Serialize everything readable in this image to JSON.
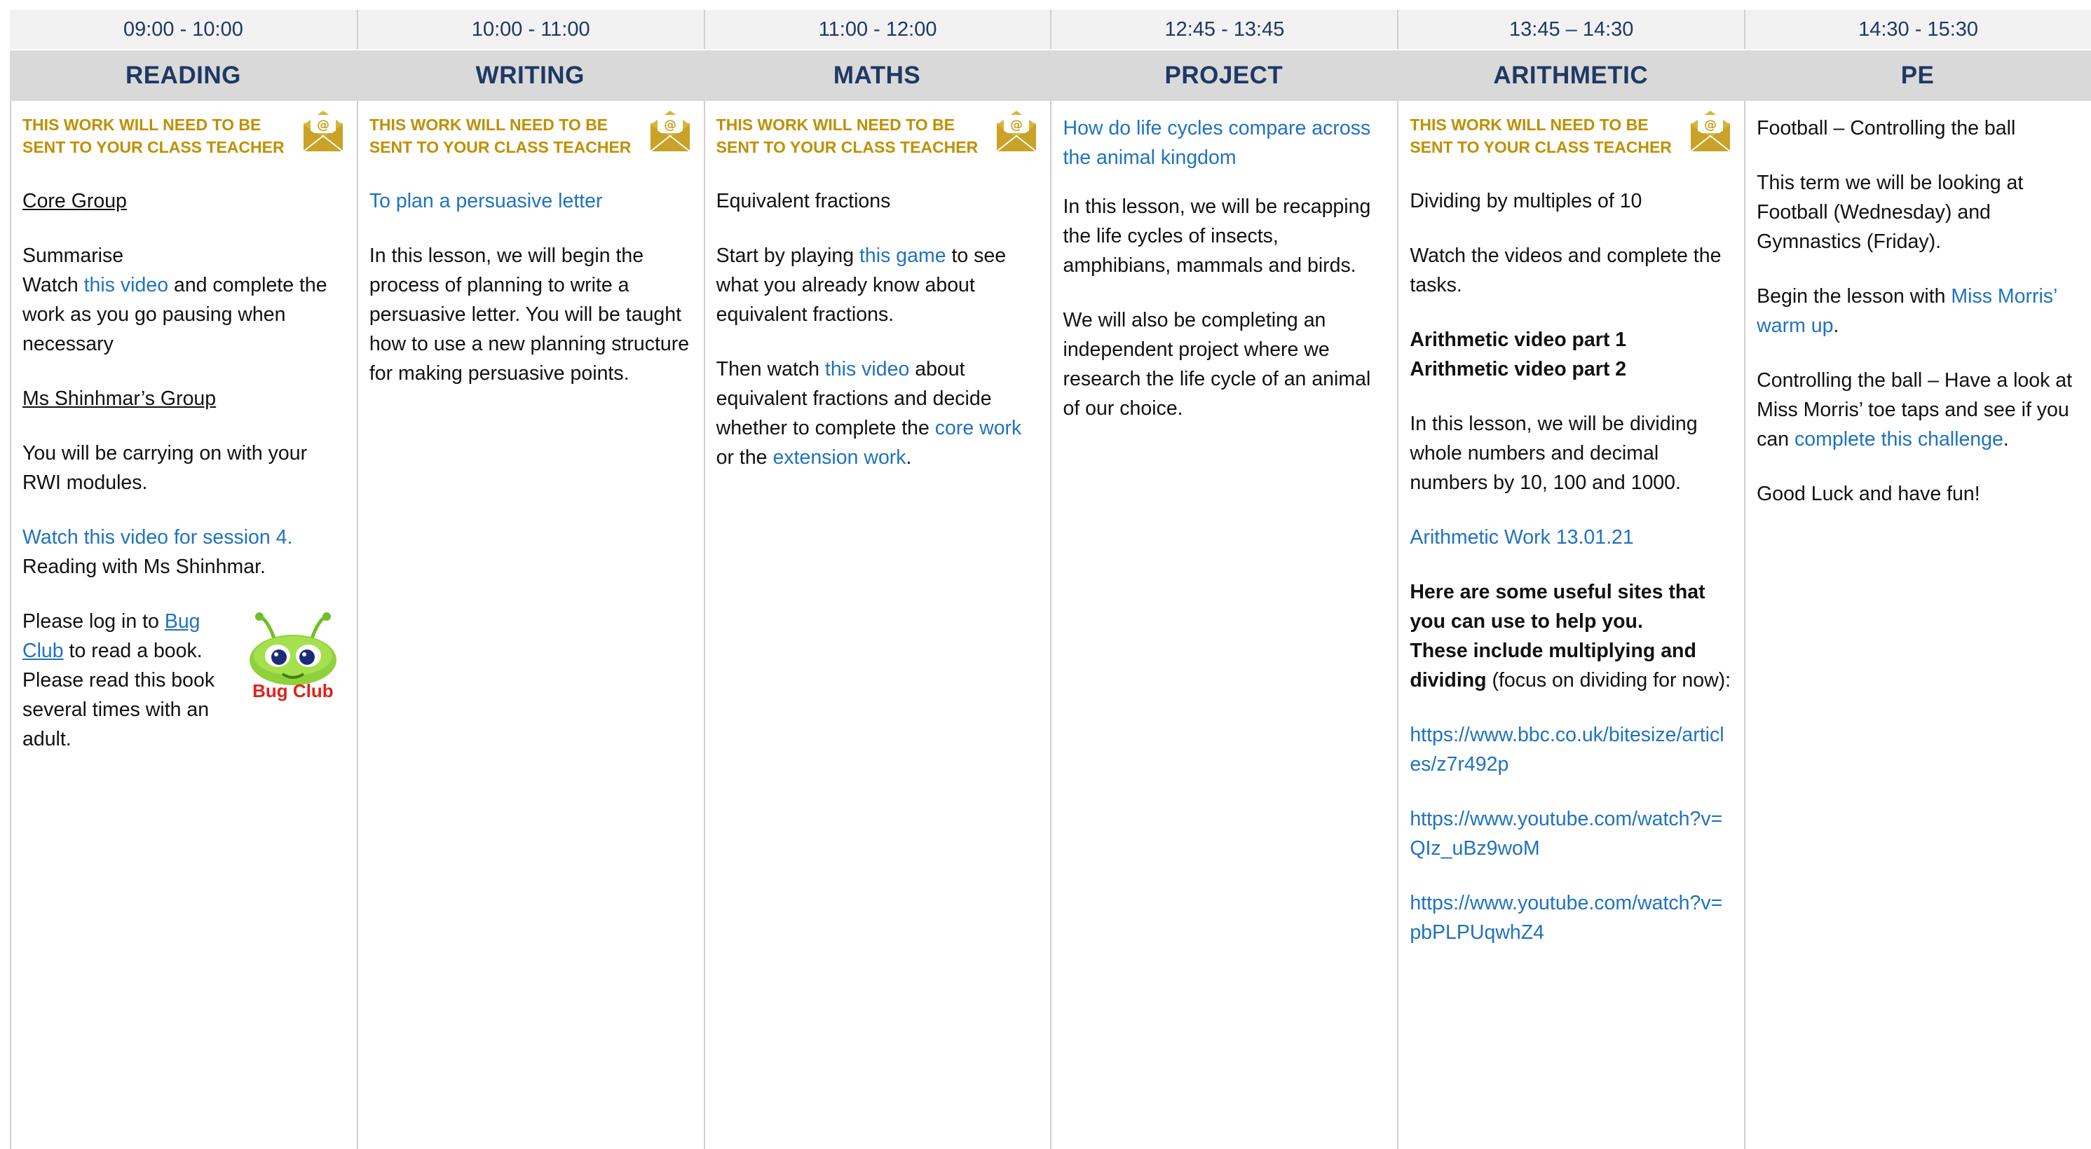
{
  "times": [
    "09:00 - 10:00",
    "10:00 - 11:00",
    "11:00 - 12:00",
    "12:45 - 13:45",
    "13:45 – 14:30",
    "14:30 - 15:30"
  ],
  "subjects": [
    "READING",
    "WRITING",
    "MATHS",
    "PROJECT",
    "ARITHMETIC",
    "PE"
  ],
  "notice": {
    "line1": "THIS WORK WILL NEED TO BE",
    "line2": "SENT TO YOUR CLASS TEACHER",
    "icon": "mail-icon",
    "color": "#bf9000"
  },
  "colors": {
    "heading": "#1f3864",
    "link": "#1f72c0",
    "time_bg": "#f2f2f2",
    "subject_bg": "#d9d9d9"
  },
  "reading": {
    "core_group": "Core Group",
    "summarise": "Summarise",
    "watch_prefix": "Watch ",
    "watch_link": "this video",
    "watch_suffix": " and complete the work as you go pausing when necessary",
    "group2": "Ms Shinhmar’s Group",
    "rwi": "You will be carrying on with your RWI modules.",
    "session_link": "Watch this video for session 4.",
    "session_text": "Reading with Ms Shinhmar.",
    "bug_prefix": "Please log in to ",
    "bug_link1": "Bug",
    "bug_link2": "Club",
    "bug_suffix": " to read a book. Please read this book several times with an adult.",
    "bug_logo": "Bug Club"
  },
  "writing": {
    "objective": "To plan a persuasive letter",
    "body": "In this lesson, we will begin the process of planning to write a persuasive letter. You will be taught how to use a new planning structure for making persuasive points."
  },
  "maths": {
    "topic": "Equivalent fractions",
    "start_prefix": "Start by playing ",
    "game_link": "this game",
    "start_suffix": " to see what you already know about equivalent fractions.",
    "then_prefix": "Then watch ",
    "video_link": "this video",
    "then_mid": " about equivalent fractions and decide whether to complete the ",
    "core_link": "core work",
    "or_text": " or the ",
    "extension_link": "extension work",
    "end": "."
  },
  "project": {
    "question": "How do life cycles compare across the animal kingdom",
    "para1": "In this lesson, we will be recapping the life cycles of insects, amphibians, mammals and birds.",
    "para2": "We will also be completing an independent project where we research the life cycle of an animal of our choice."
  },
  "arithmetic": {
    "topic": "Dividing by multiples of 10",
    "watch": "Watch the videos and complete the tasks.",
    "video1": "Arithmetic video part 1",
    "video2": "Arithmetic video part 2",
    "lesson": "In this lesson, we will be dividing whole numbers and decimal numbers by 10, 100 and 1000.",
    "work_link": "Arithmetic Work 13.01.21",
    "sites_bold1": "Here are some useful sites that you can use to help you.",
    "sites_bold2": "These include multiplying and dividing",
    "sites_note": " (focus on dividing for now):",
    "url1": "https://www.bbc.co.uk/bitesize/articles/z7r492p",
    "url2": "https://www.youtube.com/watch?v=QIz_uBz9woM",
    "url3": "https://www.youtube.com/watch?v=pbPLPUqwhZ4"
  },
  "pe": {
    "title": "Football – Controlling the ball",
    "term": "This term we will be looking at Football (Wednesday) and Gymnastics (Friday).",
    "begin_prefix": "Begin the lesson with ",
    "warmup_link": "Miss Morris’ warm up",
    "begin_suffix": ".",
    "control_prefix": "Controlling the ball – Have a look at Miss Morris’ toe taps and see if you can ",
    "challenge_link": "complete this challenge",
    "control_suffix": ".",
    "goodluck": "Good Luck and have fun!"
  }
}
